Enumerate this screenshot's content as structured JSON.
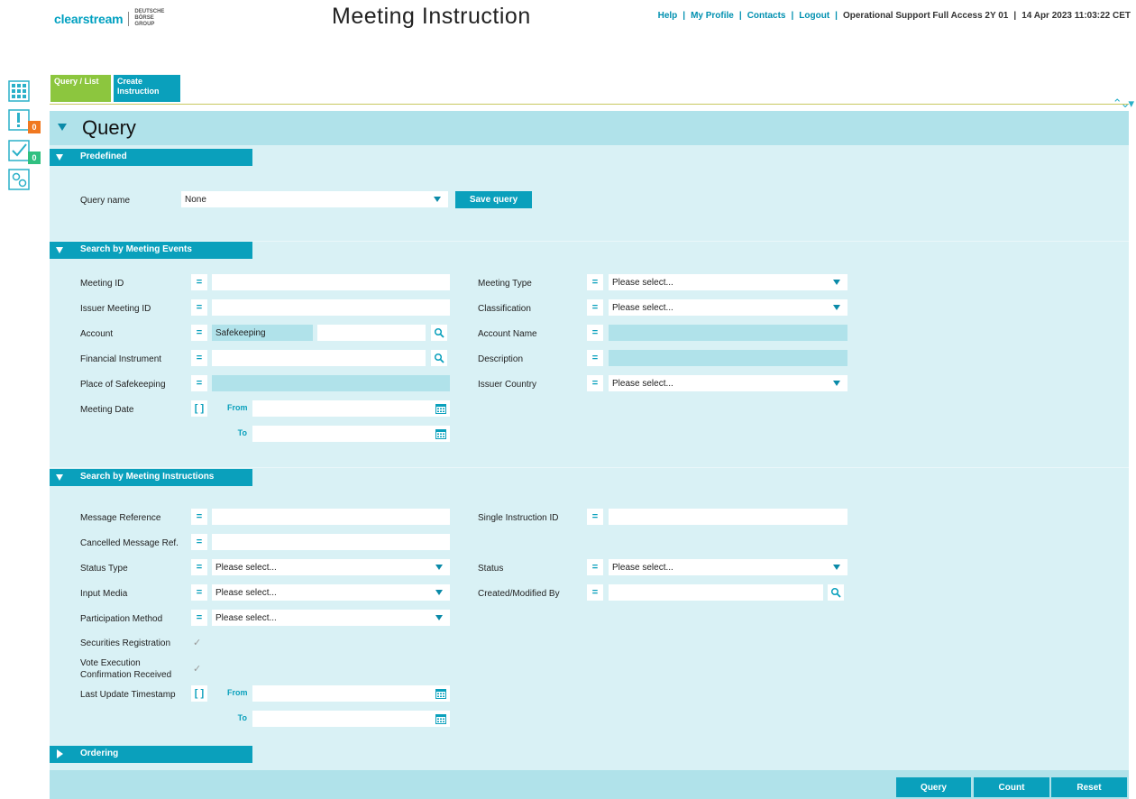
{
  "header": {
    "brand_name": "clearstream",
    "brand_group": "DEUTSCHE BÖRSE GROUP",
    "page_title": "Meeting Instruction",
    "links": [
      "Help",
      "My Profile",
      "Contacts",
      "Logout"
    ],
    "access_text": "Operational Support Full Access 2Y 01",
    "timestamp": "14 Apr 2023 11:03:22 CET"
  },
  "sidebar": {
    "items": [
      {
        "icon": "grid-icon",
        "badge": ""
      },
      {
        "icon": "alert-icon",
        "badge": "0",
        "badge_color": "#f07820"
      },
      {
        "icon": "check-icon",
        "badge": "0",
        "badge_color": "#30c080"
      },
      {
        "icon": "settings-icon",
        "badge": ""
      }
    ]
  },
  "tabs": {
    "query_list": "Query / List",
    "create_instruction": "Create Instruction"
  },
  "query": {
    "title": "Query",
    "predefined": {
      "title": "Predefined",
      "query_name_label": "Query name",
      "query_name_value": "None",
      "save_button": "Save query"
    },
    "events": {
      "title": "Search by Meeting Events",
      "meeting_id": {
        "label": "Meeting ID",
        "op": "=",
        "value": ""
      },
      "issuer_meeting_id": {
        "label": "Issuer Meeting ID",
        "op": "=",
        "value": ""
      },
      "account": {
        "label": "Account",
        "op": "=",
        "type_value": "Safekeeping",
        "value": ""
      },
      "financial_instrument": {
        "label": "Financial Instrument",
        "op": "=",
        "value": ""
      },
      "place_of_safekeeping": {
        "label": "Place of Safekeeping",
        "op": "=",
        "value": ""
      },
      "meeting_date": {
        "label": "Meeting Date",
        "op": "[ ]",
        "from_label": "From",
        "to_label": "To"
      },
      "meeting_type": {
        "label": "Meeting Type",
        "op": "=",
        "value": "Please select..."
      },
      "classification": {
        "label": "Classification",
        "op": "=",
        "value": "Please select..."
      },
      "account_name": {
        "label": "Account Name",
        "op": "=",
        "value": ""
      },
      "description": {
        "label": "Description",
        "op": "=",
        "value": ""
      },
      "issuer_country": {
        "label": "Issuer Country",
        "op": "=",
        "value": "Please select..."
      }
    },
    "instructions": {
      "title": "Search by Meeting Instructions",
      "message_reference": {
        "label": "Message Reference",
        "op": "=",
        "value": ""
      },
      "cancelled_message_ref": {
        "label": "Cancelled Message Ref.",
        "op": "=",
        "value": ""
      },
      "status_type": {
        "label": "Status Type",
        "op": "=",
        "value": "Please select..."
      },
      "input_media": {
        "label": "Input Media",
        "op": "=",
        "value": "Please select..."
      },
      "participation_method": {
        "label": "Participation Method",
        "op": "=",
        "value": "Please select..."
      },
      "securities_registration": {
        "label": "Securities Registration"
      },
      "vote_execution": {
        "label_line1": "Vote Execution",
        "label_line2": "Confirmation Received"
      },
      "last_update_timestamp": {
        "label": "Last Update Timestamp",
        "op": "[ ]",
        "from_label": "From",
        "to_label": "To"
      },
      "single_instruction_id": {
        "label": "Single Instruction ID",
        "op": "=",
        "value": ""
      },
      "status": {
        "label": "Status",
        "op": "=",
        "value": "Please select..."
      },
      "created_modified_by": {
        "label": "Created/Modified By",
        "op": "=",
        "value": ""
      }
    },
    "ordering": {
      "title": "Ordering"
    }
  },
  "footer": {
    "query_button": "Query",
    "count_button": "Count",
    "reset_button": "Reset"
  },
  "colors": {
    "accent": "#0aa0bc",
    "panel": "#d9f1f5",
    "header_band": "#b0e2ea",
    "tab_active": "#8cc63e"
  }
}
